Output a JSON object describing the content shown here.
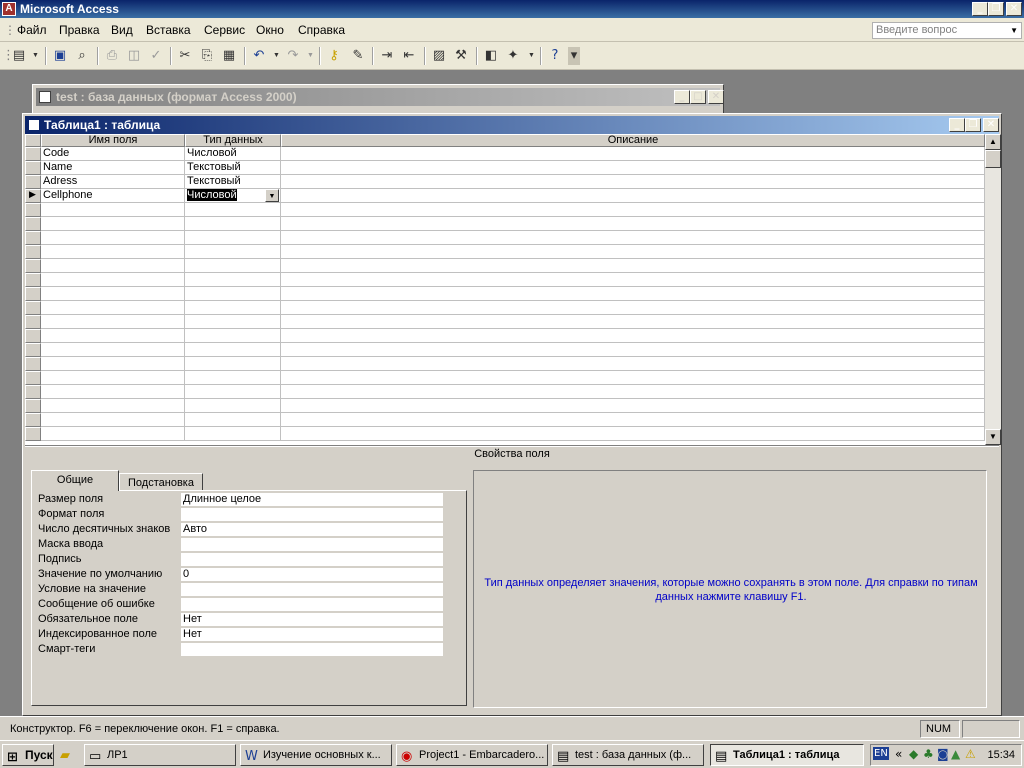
{
  "app": {
    "title": "Microsoft Access"
  },
  "menu": {
    "items": [
      "Файл",
      "Правка",
      "Вид",
      "Вставка",
      "Сервис",
      "Окно",
      "Справка"
    ],
    "help_placeholder": "Введите вопрос"
  },
  "db_window": {
    "title": "test : база данных (формат Access 2000)"
  },
  "table_window": {
    "title": "Таблица1 : таблица"
  },
  "grid": {
    "headers": {
      "field": "Имя поля",
      "type": "Тип данных",
      "desc": "Описание"
    },
    "rows": [
      {
        "field": "Code",
        "type": "Числовой",
        "desc": ""
      },
      {
        "field": "Name",
        "type": "Текстовый",
        "desc": ""
      },
      {
        "field": "Adress",
        "type": "Текстовый",
        "desc": ""
      },
      {
        "field": "Cellphone",
        "type": "Числовой",
        "desc": ""
      }
    ]
  },
  "props": {
    "section_label": "Свойства поля",
    "tabs": [
      "Общие",
      "Подстановка"
    ],
    "rows": [
      {
        "label": "Размер поля",
        "value": "Длинное целое"
      },
      {
        "label": "Формат поля",
        "value": ""
      },
      {
        "label": "Число десятичных знаков",
        "value": "Авто"
      },
      {
        "label": "Маска ввода",
        "value": ""
      },
      {
        "label": "Подпись",
        "value": ""
      },
      {
        "label": "Значение по умолчанию",
        "value": "0"
      },
      {
        "label": "Условие на значение",
        "value": ""
      },
      {
        "label": "Сообщение об ошибке",
        "value": ""
      },
      {
        "label": "Обязательное поле",
        "value": "Нет"
      },
      {
        "label": "Индексированное поле",
        "value": "Нет"
      },
      {
        "label": "Смарт-теги",
        "value": ""
      }
    ],
    "hint": "Тип данных определяет значения, которые можно сохранять в этом поле.  Для справки по типам данных нажмите клавишу F1."
  },
  "status": {
    "text": "Конструктор.  F6 = переключение окон.  F1 = справка.",
    "num": "NUM"
  },
  "taskbar": {
    "start": "Пуск",
    "tasks": [
      "ЛР1",
      "Изучение основных к...",
      "Project1 - Embarcadero...",
      "test : база данных (ф...",
      "Таблица1 : таблица"
    ],
    "lang": "EN",
    "clock": "15:34"
  },
  "colors": {
    "title_active": "#0a246a",
    "hint_text": "#0000c8"
  }
}
